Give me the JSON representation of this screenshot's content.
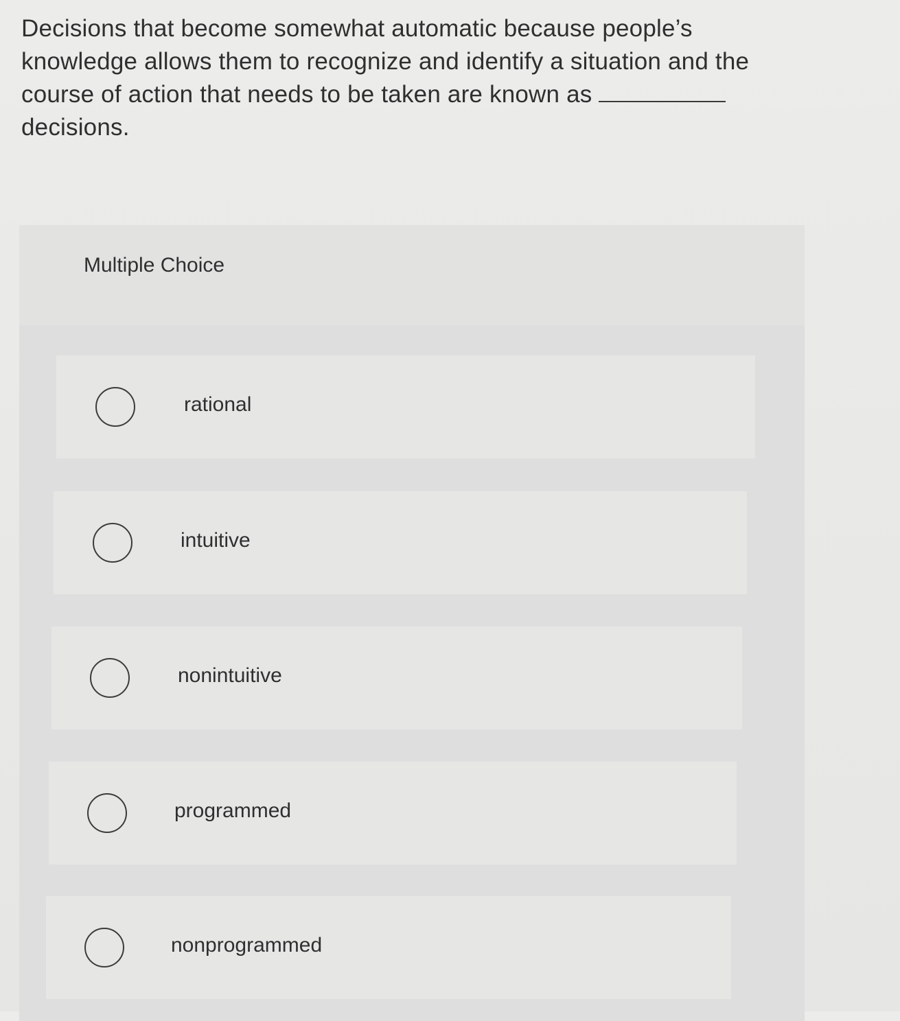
{
  "question": {
    "text_before_blank": "Decisions that become somewhat automatic because people’s knowledge allows them to recognize and identify a situation and the course of action that needs to be taken are known as",
    "text_after_blank": "decisions."
  },
  "panel": {
    "title": "Multiple Choice"
  },
  "options": [
    {
      "label": "rational",
      "selected": false
    },
    {
      "label": "intuitive",
      "selected": false
    },
    {
      "label": "nonintuitive",
      "selected": false
    },
    {
      "label": "programmed",
      "selected": false
    },
    {
      "label": "nonprogrammed",
      "selected": false
    }
  ]
}
